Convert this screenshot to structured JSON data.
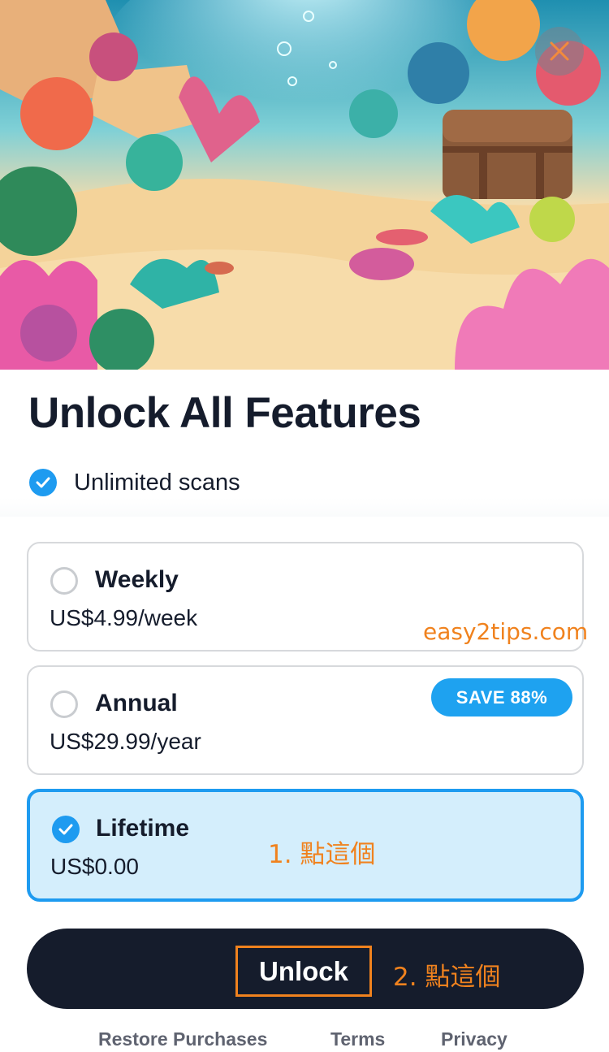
{
  "hero": {
    "image_alt": "underwater coral reef illustration with treasure chest"
  },
  "close_icon": "close-icon",
  "title": "Unlock All Features",
  "features": [
    {
      "label": "Unlimited scans",
      "icon": "check-circle-icon"
    }
  ],
  "plans": [
    {
      "name": "Weekly",
      "price": "US$4.99/week",
      "selected": false
    },
    {
      "name": "Annual",
      "price": "US$29.99/year",
      "selected": false,
      "badge": "SAVE 88%"
    },
    {
      "name": "Lifetime",
      "price": "US$0.00",
      "selected": true
    }
  ],
  "watermark": "easy2tips.com",
  "annotations": {
    "step1": "1. 點這個",
    "step2": "2. 點這個"
  },
  "cta": {
    "label": "Unlock"
  },
  "footer": {
    "restore": "Restore Purchases",
    "terms": "Terms",
    "privacy": "Privacy"
  },
  "colors": {
    "accent": "#1e9bf0",
    "dark": "#151c2c",
    "annotation": "#f0821e",
    "selected_bg": "#d4eefc"
  }
}
